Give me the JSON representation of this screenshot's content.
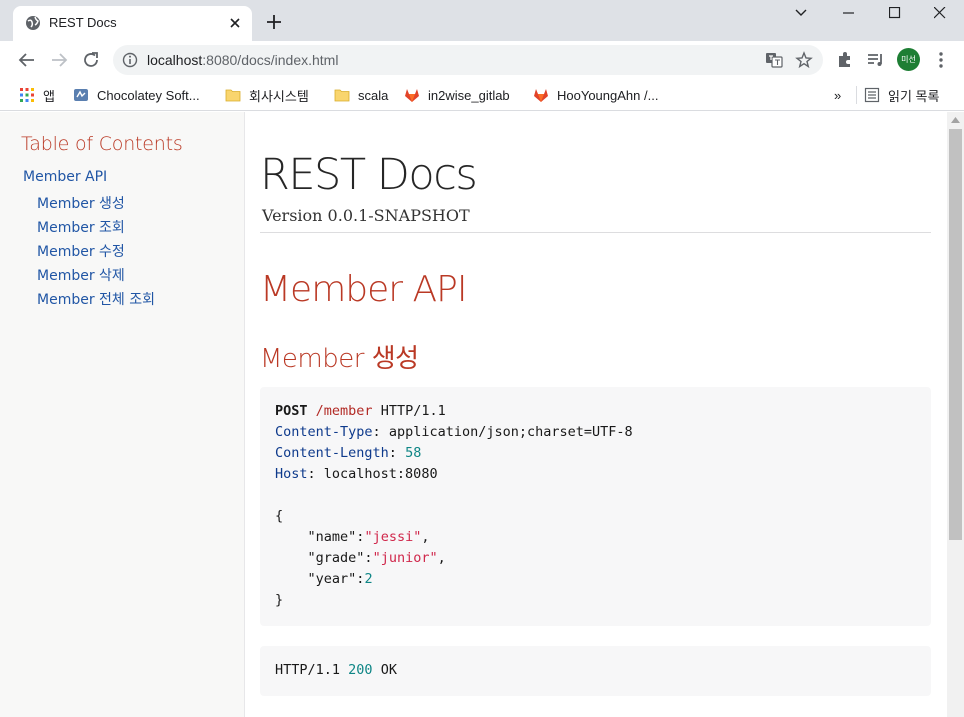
{
  "browser": {
    "tab_title": "REST Docs",
    "url_host": "localhost",
    "url_path": ":8080/docs/index.html",
    "profile_label": "미선",
    "bookmarks": [
      {
        "label": "앱",
        "icon": "apps-grid-icon"
      },
      {
        "label": "Chocolatey Soft...",
        "icon": "chocolatey-icon"
      },
      {
        "label": "회사시스템",
        "icon": "folder-icon"
      },
      {
        "label": "scala",
        "icon": "folder-icon"
      },
      {
        "label": "in2wise_gitlab",
        "icon": "gitlab-icon"
      },
      {
        "label": "HooYoungAhn /...",
        "icon": "gitlab-icon"
      }
    ],
    "more_bookmarks_label": "»",
    "reading_list_label": "읽기 목록"
  },
  "toc": {
    "title": "Table of Contents",
    "items": [
      {
        "label": "Member API",
        "level": 1
      },
      {
        "label": "Member 생성",
        "level": 2
      },
      {
        "label": "Member 조회",
        "level": 2
      },
      {
        "label": "Member 수정",
        "level": 2
      },
      {
        "label": "Member 삭제",
        "level": 2
      },
      {
        "label": "Member 전체 조회",
        "level": 2
      }
    ]
  },
  "doc": {
    "title": "REST Docs",
    "version": "Version 0.0.1-SNAPSHOT",
    "section_title": "Member API",
    "subsection_title": "Member 생성",
    "request": {
      "method": "POST",
      "path": "/member",
      "protocol": "HTTP/1.1",
      "headers": [
        {
          "name": "Content-Type",
          "value": "application/json;charset=UTF-8"
        },
        {
          "name": "Content-Length",
          "value": "58"
        },
        {
          "name": "Host",
          "value": "localhost:8080"
        }
      ],
      "body": [
        {
          "key": "\"name\"",
          "value": "\"jessi\"",
          "kind": "str",
          "comma": ","
        },
        {
          "key": "\"grade\"",
          "value": "\"junior\"",
          "kind": "str",
          "comma": ","
        },
        {
          "key": "\"year\"",
          "value": "2",
          "kind": "num",
          "comma": ""
        }
      ]
    },
    "response": {
      "protocol": "HTTP/1.1",
      "status_code": "200",
      "status_text": "OK"
    }
  },
  "colors": {
    "heading": "#ba3925",
    "link": "#2156a5",
    "string": "#d0274b",
    "number": "#0f8686",
    "header_name": "#0e3a8c"
  }
}
